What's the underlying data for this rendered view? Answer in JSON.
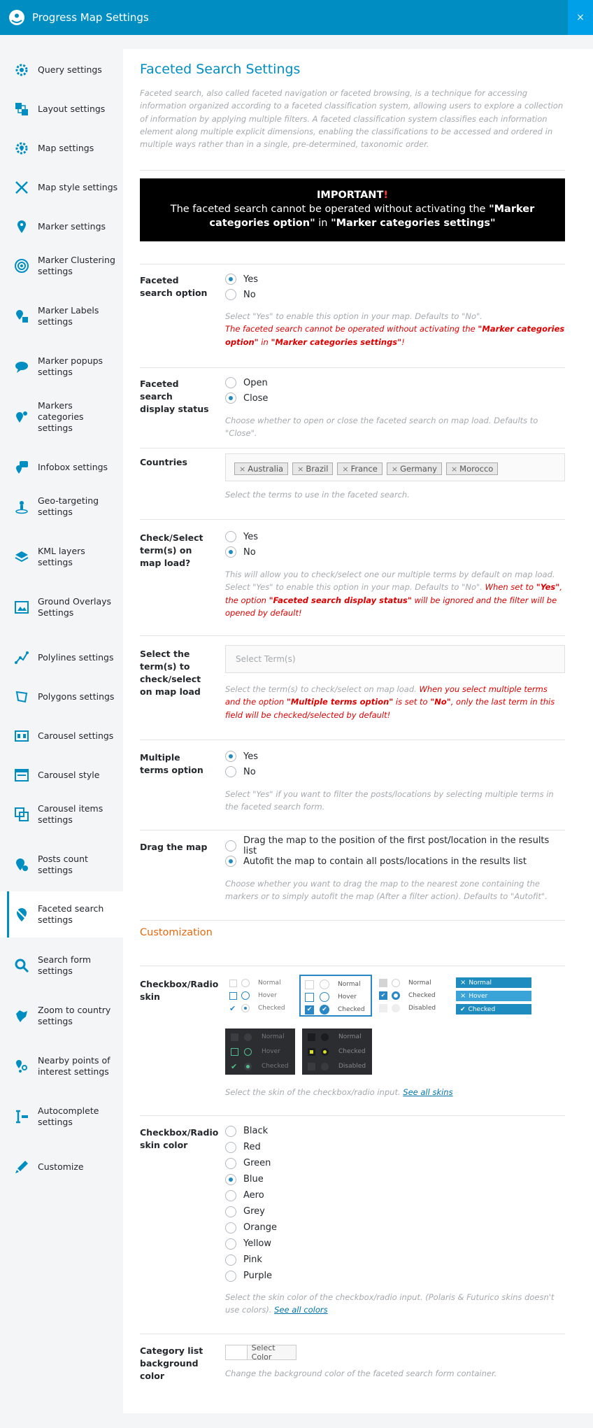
{
  "header": {
    "title": "Progress Map Settings",
    "close_label": "×"
  },
  "sidebar": {
    "items": [
      {
        "label": "Query settings",
        "icon": "gear-icon"
      },
      {
        "label": "Layout settings",
        "icon": "layout-icon"
      },
      {
        "label": "Map settings",
        "icon": "map-gear-icon"
      },
      {
        "label": "Map style settings",
        "icon": "brush-icon"
      },
      {
        "label": "Marker settings",
        "icon": "marker-icon"
      },
      {
        "label": "Marker Clustering settings",
        "icon": "cluster-icon"
      },
      {
        "label": "Marker Labels settings",
        "icon": "marker-label-icon"
      },
      {
        "label": "Marker popups settings",
        "icon": "popup-icon"
      },
      {
        "label": "Markers categories settings",
        "icon": "markers-categories-icon"
      },
      {
        "label": "Infobox settings",
        "icon": "infobox-icon"
      },
      {
        "label": "Geo-targeting settings",
        "icon": "geo-target-icon"
      },
      {
        "label": "KML layers settings",
        "icon": "layers-icon"
      },
      {
        "label": "Ground Overlays Settings",
        "icon": "ground-overlay-icon"
      },
      {
        "label": "Polylines settings",
        "icon": "polyline-icon"
      },
      {
        "label": "Polygons settings",
        "icon": "polygon-icon"
      },
      {
        "label": "Carousel settings",
        "icon": "carousel-icon"
      },
      {
        "label": "Carousel style",
        "icon": "carousel-style-icon"
      },
      {
        "label": "Carousel items settings",
        "icon": "carousel-items-icon"
      },
      {
        "label": "Posts count settings",
        "icon": "posts-count-icon"
      },
      {
        "label": "Faceted search settings",
        "icon": "faceted-search-icon"
      },
      {
        "label": "Search form settings",
        "icon": "search-icon"
      },
      {
        "label": "Zoom to country settings",
        "icon": "zoom-country-icon"
      },
      {
        "label": "Nearby points of interest settings",
        "icon": "nearby-poi-icon"
      },
      {
        "label": "Autocomplete settings",
        "icon": "autocomplete-icon"
      },
      {
        "label": "Customize",
        "icon": "customize-icon"
      }
    ]
  },
  "page": {
    "title": "Faceted Search Settings",
    "intro": "Faceted search, also called faceted navigation or faceted browsing, is a technique for accessing information organized according to a faceted classification system, allowing users to explore a collection of information by applying multiple filters. A faceted classification system classifies each information element along multiple explicit dimensions, enabling the classifications to be accessed and ordered in multiple ways rather than in a single, pre-determined, taxonomic order.",
    "important": {
      "heading": "IMPORTANT",
      "heading_mark": "!",
      "text_1": "The faceted search cannot be operated without activating the ",
      "bold_1": "\"Marker categories option\"",
      "text_2": " in ",
      "bold_2": "\"Marker categories settings\""
    }
  },
  "fields": {
    "faceted_option": {
      "label": "Faceted search option",
      "options": [
        "Yes",
        "No"
      ],
      "selected": "Yes",
      "help": "Select \"Yes\" to enable this option in your map. Defaults to \"No\".",
      "warn_1": "The faceted search cannot be operated without activating the ",
      "warn_bold_1": "\"Marker categories option\"",
      "warn_2": " in ",
      "warn_bold_2": "\"Marker categories settings\"",
      "warn_3": "!"
    },
    "display_status": {
      "label": "Faceted search display status",
      "options": [
        "Open",
        "Close"
      ],
      "selected": "Close",
      "help": "Choose whether to open or close the faceted search on map load. Defaults to \"Close\"."
    },
    "countries": {
      "label": "Countries",
      "tags": [
        "Australia",
        "Brazil",
        "France",
        "Germany",
        "Morocco"
      ],
      "tag_remove": "×",
      "help": "Select the terms to use in the faceted search."
    },
    "check_on_load": {
      "label": "Check/Select term(s) on map load?",
      "options": [
        "Yes",
        "No"
      ],
      "selected": "No",
      "help_1": "This will allow you to check/select one our multiple terms by default on map load.",
      "help_2": "Select \"Yes\" to enable this option in your map. Defaults to \"No\". ",
      "warn_1": "When set to ",
      "warn_bold_1": "\"Yes\"",
      "warn_2": ", the option ",
      "warn_bold_2": "\"Faceted search display status\"",
      "warn_3": " will be ignored and the filter will be opened by default!"
    },
    "select_terms": {
      "label": "Select the term(s) to check/select on map load",
      "placeholder": "Select Term(s)",
      "help_1": "Select the term(s) to check/select on map load. ",
      "warn_1": "When you select multiple terms and the option ",
      "warn_bold_1": "\"Multiple terms option\"",
      "warn_2": " is set to ",
      "warn_bold_2": "\"No\"",
      "warn_3": ", only the last term in this field will be checked/selected by default!"
    },
    "multiple_terms": {
      "label": "Multiple terms option",
      "options": [
        "Yes",
        "No"
      ],
      "selected": "Yes",
      "help": "Select \"Yes\" if you want to filter the posts/locations by selecting multiple terms in the faceted search form."
    },
    "drag_map": {
      "label": "Drag the map",
      "options": [
        "Drag the map to the position of the first post/location in the results list",
        "Autofit the map to contain all posts/locations in the results list"
      ],
      "selected": "Autofit the map to contain all posts/locations in the results list",
      "help": "Choose whether you want to drag the map to the nearest zone containing the markers or to simply autofit the map (After a filter action). Defaults to \"Autofit\"."
    },
    "customization_title": "Customization",
    "skin": {
      "label": "Checkbox/Radio skin",
      "states_a": [
        "Normal",
        "Hover",
        "Checked"
      ],
      "states_b": [
        "Normal",
        "Checked",
        "Disabled"
      ],
      "states_c": [
        "Normal",
        "Hover",
        "Checked"
      ],
      "states_d": [
        "Normal",
        "Checked",
        "Disabled"
      ],
      "help": "Select the skin of the checkbox/radio input. ",
      "help_link": "See all skins"
    },
    "skin_color": {
      "label": "Checkbox/Radio skin color",
      "options": [
        "Black",
        "Red",
        "Green",
        "Blue",
        "Aero",
        "Grey",
        "Orange",
        "Yellow",
        "Pink",
        "Purple"
      ],
      "selected": "Blue",
      "help": "Select the skin color of the checkbox/radio input. (Polaris & Futurico skins doesn't use colors). ",
      "help_link": "See all colors"
    },
    "bg_color": {
      "label": "Category list background color",
      "button": "Select Color",
      "help": "Change the background color of the faceted search form container."
    }
  },
  "colors": {
    "accent": "#008ec2",
    "warning": "#dd0000",
    "orange": "#e8680c",
    "skin_blue": "#2a87c6"
  }
}
